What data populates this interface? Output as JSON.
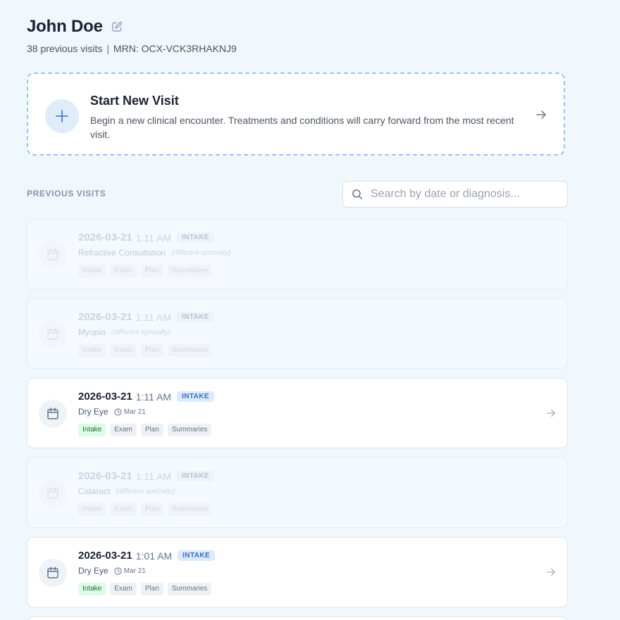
{
  "patient": {
    "name": "John Doe",
    "visit_count": "38 previous visits",
    "mrn": "MRN: OCX-VCK3RHAKNJ9"
  },
  "new_visit": {
    "title": "Start New Visit",
    "description": "Begin a new clinical encounter. Treatments and conditions will carry forward from the most recent visit."
  },
  "section_label": "PREVIOUS VISITS",
  "search": {
    "placeholder": "Search by date or diagnosis..."
  },
  "visits": [
    {
      "date": "2026-03-21",
      "time": "1:11 AM",
      "type": "INTAKE",
      "diagnosis": "Refractive Consultation",
      "note": "(different specialty)",
      "tags": [
        "Intake",
        "Exam",
        "Plan",
        "Summaries"
      ]
    },
    {
      "date": "2026-03-21",
      "time": "1:11 AM",
      "type": "INTAKE",
      "diagnosis": "Myopia",
      "note": "(different specialty)",
      "tags": [
        "Intake",
        "Exam",
        "Plan",
        "Summaries"
      ]
    },
    {
      "date": "2026-03-21",
      "time": "1:11 AM",
      "type": "INTAKE",
      "diagnosis": "Dry Eye",
      "updated": "Mar 21",
      "tags": [
        "Intake",
        "Exam",
        "Plan",
        "Summaries"
      ]
    },
    {
      "date": "2026-03-21",
      "time": "1:11 AM",
      "type": "INTAKE",
      "diagnosis": "Cataract",
      "note": "(different specialty)",
      "tags": [
        "Intake",
        "Exam",
        "Plan",
        "Summaries"
      ]
    },
    {
      "date": "2026-03-21",
      "time": "1:01 AM",
      "type": "INTAKE",
      "diagnosis": "Dry Eye",
      "updated": "Mar 21",
      "tags": [
        "Intake",
        "Exam",
        "Plan",
        "Summaries"
      ]
    }
  ],
  "colors": {
    "background": "#f0f7fd",
    "accent": "#3b82f6",
    "dashed_border": "#93c5fd",
    "tag_done_bg": "#dcfce7"
  },
  "icons": {
    "edit": "pencil-square-icon",
    "add": "plus-icon",
    "arrow": "arrow-right-icon",
    "search": "search-icon",
    "visit": "calendar-icon",
    "updated": "clock-icon"
  }
}
